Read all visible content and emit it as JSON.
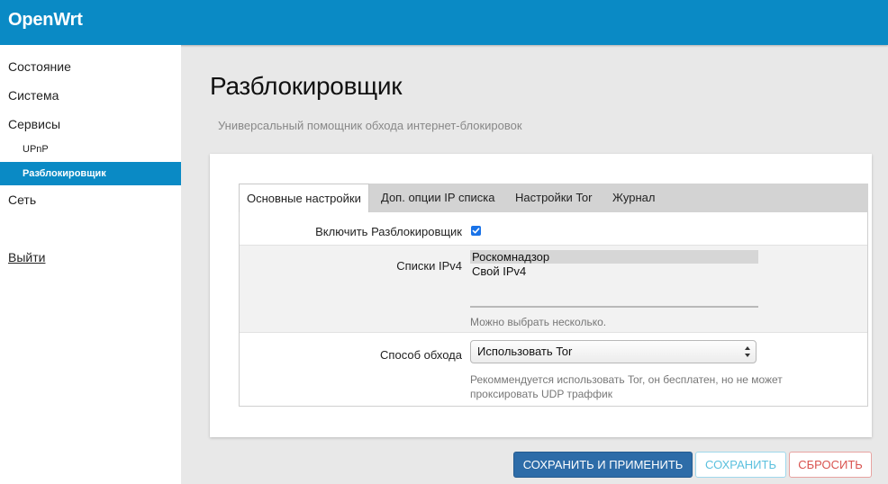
{
  "header": {
    "brand": "OpenWrt"
  },
  "sidebar": {
    "items": [
      {
        "label": "Состояние"
      },
      {
        "label": "Система"
      },
      {
        "label": "Сервисы"
      },
      {
        "label": "UPnP"
      },
      {
        "label": "Разблокировщик",
        "active": true
      },
      {
        "label": "Сеть"
      }
    ],
    "logout": "Выйти"
  },
  "page": {
    "title": "Разблокировщик",
    "description": "Универсальный помощник обхода интернет-блокировок"
  },
  "tabs": [
    {
      "label": "Основные настройки",
      "active": true
    },
    {
      "label": "Доп. опции IP списка"
    },
    {
      "label": "Настройки Tor"
    },
    {
      "label": "Журнал"
    }
  ],
  "form": {
    "enable": {
      "label": "Включить Разблокировщик",
      "checked": true
    },
    "ipv4_lists": {
      "label": "Списки IPv4",
      "options": [
        {
          "label": "Роскомнадзор",
          "selected": true
        },
        {
          "label": "Свой IPv4",
          "selected": false
        }
      ],
      "hint": "Можно выбрать несколько."
    },
    "bypass": {
      "label": "Способ обхода",
      "value": "Использовать Tor",
      "hint_line1": "Рекоммендуется использовать Tor, он бесплатен, но не может",
      "hint_line2": "проксировать UDP траффик"
    }
  },
  "buttons": {
    "save_apply": "СОХРАНИТЬ И ПРИМЕНИТЬ",
    "save": "СОХРАНИТЬ",
    "reset": "СБРОСИТЬ"
  },
  "colors": {
    "accent": "#0a8ac5",
    "primary_button": "#2d6ca8",
    "info": "#5bc0de",
    "danger": "#d9534f"
  }
}
